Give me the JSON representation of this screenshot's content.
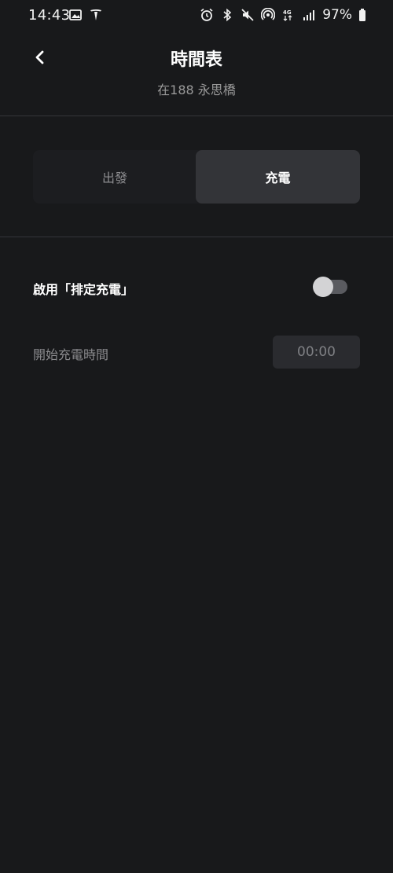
{
  "status_bar": {
    "time": "14:43",
    "battery": "97%",
    "left_icons": [
      "gallery-icon",
      "tesla-icon"
    ],
    "right_icons": [
      "alarm-icon",
      "bluetooth-icon",
      "mute-icon",
      "hotspot-icon",
      "4g-icon",
      "signal-icon",
      "battery-icon"
    ]
  },
  "header": {
    "title": "時間表",
    "subtitle": "在188 永思橋"
  },
  "tabs": [
    {
      "label": "出發",
      "selected": false
    },
    {
      "label": "充電",
      "selected": true
    }
  ],
  "settings": {
    "enable_label": "啟用「排定充電」",
    "enable_on": false,
    "start_time_label": "開始充電時間",
    "start_time_value": "00:00"
  },
  "colors": {
    "background": "#18191b",
    "selected_tab": "#333438",
    "text_primary": "#ffffff",
    "text_secondary": "#9a9a9a"
  }
}
